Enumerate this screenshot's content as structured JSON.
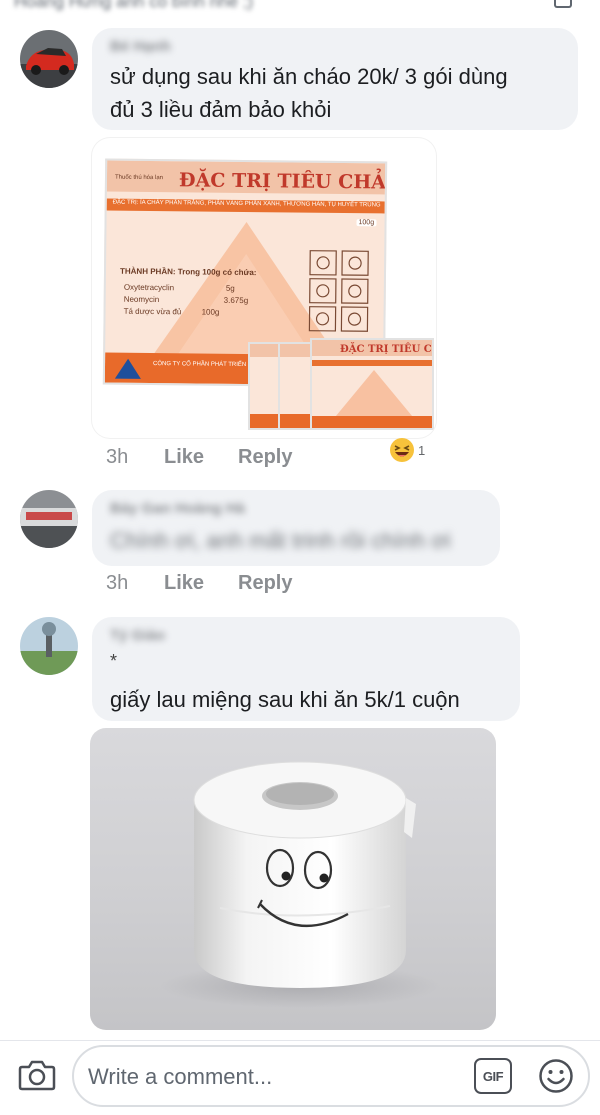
{
  "top": {
    "cut_text": "Hoàng Hưng anh có bình nhé ;)"
  },
  "comments": [
    {
      "author": "Bé Hạnh",
      "text_line1": "sử dụng sau khi ăn cháo 20k/ 3 gói dùng",
      "text_line2": "đủ 3 liều đảm bảo khỏi",
      "image": {
        "label_small": "Thuốc thú hóa lan",
        "title": "ĐẶC TRỊ TIÊU CHẢY",
        "subtitle": "ĐẶC TRỊ: ỈA CHẢY PHÂN TRẮNG, PHÂN VÀNG PHÂN XANH, THƯƠNG HÀN, TỤ HUYẾT TRÙNG",
        "weight": "100g",
        "ingredients_heading": "THÀNH PHẦN: Trong 100g có chứa:",
        "ingredients": [
          {
            "name": "Oxytetracyclin",
            "amount": "5g"
          },
          {
            "name": "Neomycin",
            "amount": "3.675g"
          },
          {
            "name": "Tá dược vừa đủ",
            "amount": "100g"
          }
        ],
        "company": "CÔNG TY CỔ PHẦN PHÁT TRIỂN",
        "small_title": "ĐẶC TRỊ TIÊU CHẢY"
      },
      "time": "3h",
      "like_label": "Like",
      "reply_label": "Reply",
      "reaction": {
        "icon": "laughing-emoji-icon",
        "count": "1"
      }
    },
    {
      "author": "Bảy Gan Hoàng Hà",
      "text": "Chính ơi, anh mất trinh rồi chính ơi",
      "time": "3h",
      "like_label": "Like",
      "reply_label": "Reply"
    },
    {
      "author": "Tý Giảo",
      "star": "*",
      "text": "giấy lau miệng sau khi ăn 5k/1 cuộn",
      "image": {
        "icon": "toilet-paper-roll-image"
      }
    }
  ],
  "composer": {
    "placeholder": "Write a comment...",
    "gif_label": "GIF",
    "camera_icon": "camera-icon",
    "emoji_icon": "smiley-icon"
  },
  "colors": {
    "bubble": "#f0f2f5",
    "meta_text": "#8a8d91",
    "package_orange": "#e8702f",
    "package_title": "#c0392b"
  }
}
